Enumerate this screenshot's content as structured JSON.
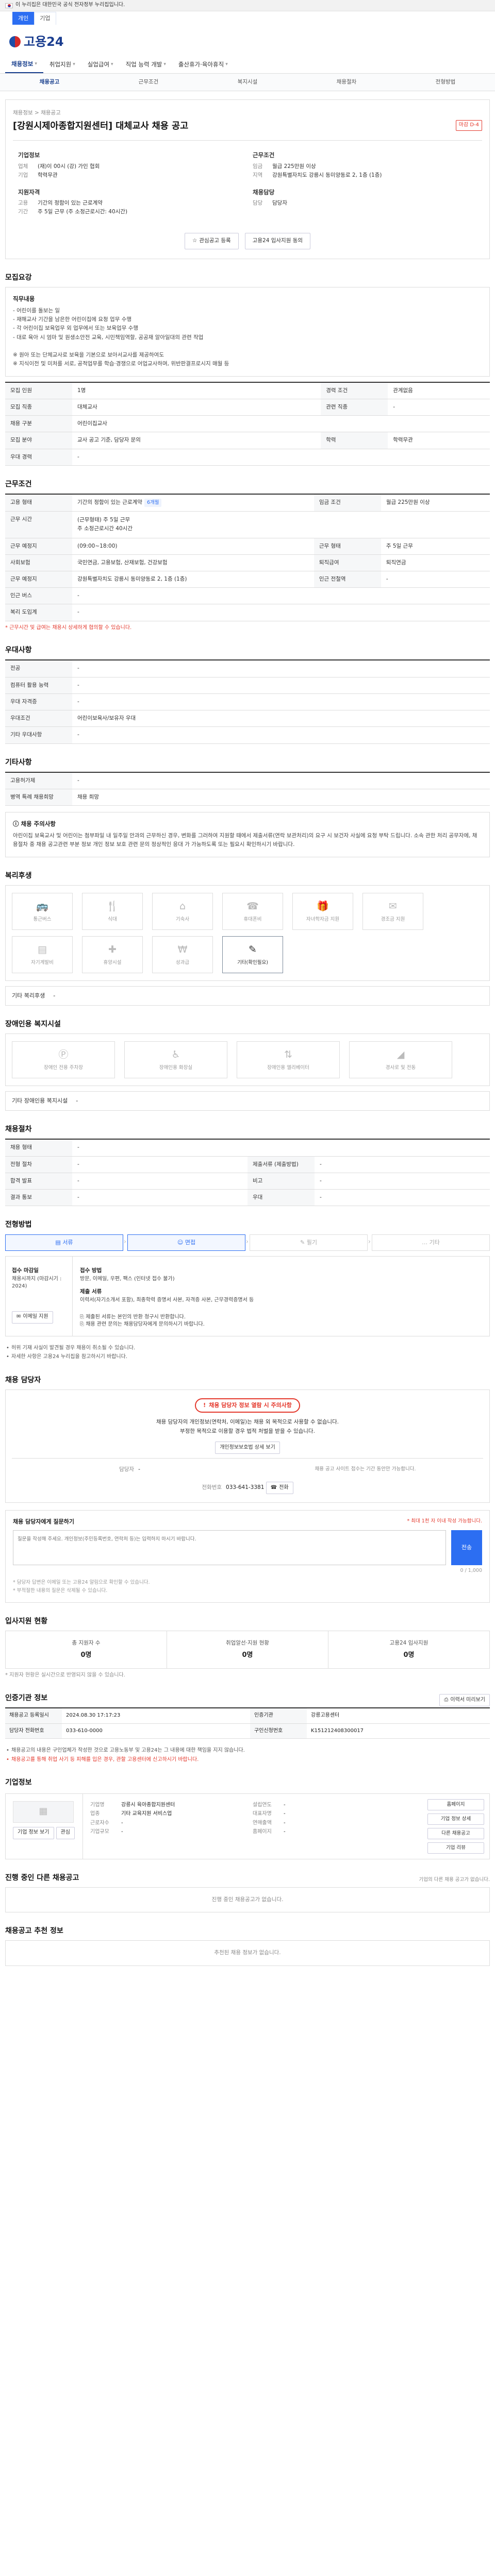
{
  "gov_banner": {
    "text": "이 누리집은 대한민국 공식 전자정부 누리집입니다."
  },
  "option_tabs": [
    "개인",
    "기업"
  ],
  "logo": {
    "text": "고용24"
  },
  "gnb": [
    "채용정보",
    "취업지원",
    "실업급여",
    "직업 능력 개발",
    "출산휴가·육아휴직"
  ],
  "subnav": [
    "채용공고",
    "근무조건",
    "복지시설",
    "채용절차",
    "전형방법"
  ],
  "header": {
    "crumb": "채용정보 > 채용공고",
    "title": "[강원시제아종합지원센터] 대체교사 채용 공고",
    "badge": "마감 D-4"
  },
  "brief": {
    "company_head": "기업정보",
    "company": [
      {
        "k": "업체",
        "v": "(재)이 00시 (강) 가인 협회"
      },
      {
        "k": "기업",
        "v": "학력무관"
      }
    ],
    "condition_head": "근무조건",
    "condition": [
      {
        "k": "임금",
        "v": "월급 225만원 이상"
      },
      {
        "k": "지역",
        "v": "강원특별자치도 강릉시 동미양동로 2, 1층 (1층)"
      }
    ],
    "requirement_head": "지원자격",
    "requirement": [
      {
        "k": "고용",
        "v": "기간의 정함이 있는 근로계약"
      },
      {
        "k": "기간",
        "v": "주 5일 근무 (주 소정근로시간: 40시간)"
      }
    ],
    "manager_head": "채용담당",
    "manager": [
      {
        "k": "담당",
        "v": "담당자"
      }
    ]
  },
  "actions": {
    "interest": "관심공고 등록",
    "share": "고용24 입사지원 동의"
  },
  "job_summary": {
    "title": "모집요강",
    "duty_head": "직무내용",
    "duty": "- 어린이를 돌보는 일\n- 재해교사 기간을 남은한 어린이집에 요청 업무 수행\n- 각 어린이집 보육업무 외 업무에서 또는 보육업무 수행\n- 대로 육아 시 엄마 및 원생소안전 교육, 시민책임역할, 공공재 알아일대의 관련 작업\n\n※ 원아 또는 단체교사로 보육을 기본으로 보아서교사를 제공하여도\n※ 지식이전 및 미처를 서로, 공적업무를 학습·경쟁으로 어업교사하며, 위반판결프로시지 매월 등",
    "rows": [
      {
        "k": "모집 인원",
        "v": "1명",
        "k2": "경력 조건",
        "v2": "관계없음"
      },
      {
        "k": "모집 직종",
        "v": "대체교사",
        "k2": "관련 직종",
        "v2": "-"
      },
      {
        "k": "채용 구분",
        "v": "어린이집교사",
        "k2": "",
        "v2": ""
      },
      {
        "k": "모집 분야",
        "v": "교사 공고 기준, 담당자 문의",
        "k2": "학력",
        "v2": "학력무관"
      },
      {
        "k": "우대 경력",
        "v": "-",
        "k2": "",
        "v2": ""
      }
    ]
  },
  "work_conditions": {
    "title": "근무조건",
    "rows": [
      {
        "k": "고용 형태",
        "v": "기간의 정함이 있는 근로계약",
        "pill": "6개월",
        "k2": "임금 조건",
        "v2": "월급 225만원 이상"
      },
      {
        "k": "근무 시간",
        "v": "(근무형태) 주 5일 근무\n주 소정근로시간 40시간",
        "k2": "",
        "v2": ""
      },
      {
        "k": "근무 예정지",
        "v": "(09:00~18:00)",
        "k2": "근무 형태",
        "v2": "주 5일 근무"
      },
      {
        "k": "사회보험",
        "v": "국민연금, 고용보험, 산재보험, 건강보험",
        "k2": "퇴직급여",
        "v2": "퇴직연금"
      },
      {
        "k": "근무 예정지",
        "v": "강원특별자치도 강릉시 동미양동로 2, 1층 (1층)",
        "k2": "인근 전철역",
        "v2": "-"
      },
      {
        "k": "인근 버스",
        "v": "-",
        "k2": "",
        "v2": ""
      },
      {
        "k": "복리 도입계",
        "v": "-",
        "k2": "",
        "v2": ""
      }
    ],
    "note": "* 근무시간 및 급여는 채용시 상세하게 협의할 수 있습니다."
  },
  "qualification": {
    "title": "우대사항",
    "rows": [
      {
        "k": "전공",
        "v": "-"
      },
      {
        "k": "컴퓨터 활용 능력",
        "v": "-"
      },
      {
        "k": "우대 자격증",
        "v": "-"
      },
      {
        "k": "우대조건",
        "v": "어린이보육사/보유자 우대"
      },
      {
        "k": "기타 우대사항",
        "v": "-"
      }
    ]
  },
  "other_conditions": {
    "title": "기타사항",
    "rows": [
      {
        "k": "고용허가제",
        "v": "-"
      },
      {
        "k": "병역 특례 채용희망",
        "v": "채용 희망"
      }
    ]
  },
  "caution": {
    "title": "채용 주의사항",
    "text": "아린이집 보육교사 및 어린이는 첨부파일 내 일주일 안과의 근무하신 경우, 변화를 그러하여 지원할 때에서 제출서류(연락 보관처리)의 요구 시 보건자 사실에 요청 부탁 드립니다. 소속 관한 처리 공무자에, 채용절차 중 채용 공고관련 부분 정보 개인 정보 보호 관련 문의 정상적인 응대 가 가능하도록 또는 필요시 확인하시기 바랍니다."
  },
  "welfare": {
    "title": "복리후생",
    "items": [
      {
        "icon": "car",
        "label": "통근버스"
      },
      {
        "icon": "meal",
        "label": "식대"
      },
      {
        "icon": "house",
        "label": "기숙사"
      },
      {
        "icon": "phone",
        "label": "휴대폰비"
      },
      {
        "icon": "gift",
        "label": "자녀학자금 지원"
      },
      {
        "icon": "bonus",
        "label": "경조금 지원"
      },
      {
        "icon": "doc",
        "label": "자기계발비"
      },
      {
        "icon": "health",
        "label": "휴양시설"
      },
      {
        "icon": "money",
        "label": "성과급"
      },
      {
        "icon": "note",
        "label": "기타(확인필요)",
        "on": true
      }
    ],
    "sub_label": "기타 복리후생",
    "sub_value": "-"
  },
  "disability": {
    "title": "장애인용 복지시설",
    "items": [
      {
        "icon": "parking",
        "label": "장애인 전용 주차장"
      },
      {
        "icon": "toilet",
        "label": "장애인용 화장실"
      },
      {
        "icon": "elevator",
        "label": "장애인용 엘리베이터"
      },
      {
        "icon": "ramp",
        "label": "경사로 및 전동"
      }
    ],
    "sub_label": "기타 장애인용 복지시설",
    "sub_value": "-"
  },
  "hiring_process": {
    "title": "채용절차",
    "rows": [
      {
        "k": "채용 형태",
        "v": "-",
        "k2": "",
        "v2": ""
      },
      {
        "k": "전형 절차",
        "v": "-",
        "k2": "제출서류 (제출방법)",
        "v2": "-"
      },
      {
        "k": "합격 발표",
        "v": "-",
        "k2": "비고",
        "v2": "-"
      },
      {
        "k": "결과 통보",
        "v": "-",
        "k2": "우대",
        "v2": "-"
      }
    ]
  },
  "selection": {
    "title": "전형방법",
    "steps": [
      {
        "label": "서류",
        "on": true
      },
      {
        "label": "면접",
        "on": true
      },
      {
        "label": "필기",
        "on": false
      },
      {
        "label": "기타",
        "on": false
      }
    ],
    "period_head": "접수 마감일",
    "period_value": "채용시까지 (마감시기 : 2024)",
    "method_head": "접수 방법",
    "method_value": "방문, 이메일, 우편, 팩스 (인터넷 접수 불가)",
    "docs_head": "제출 서류",
    "docs_value": "이력서(자기소개서 포함), 최종학력 증명서 사본, 자격증 사본, 근무경력증명서 등",
    "apply_label": "이메일 지원",
    "bullets": [
      "제출된 서류는 본인의 반환 청구시 반환합니다.",
      "채용 관련 문의는 채용담당자에게 문의하시기 바랍니다.",
      "허위 기재 사실이 발견될 경우 채용이 취소될 수 있습니다.",
      "자세한 사항은 고용24 누리집을 참고하시기 바랍니다."
    ]
  },
  "manager_section": {
    "title": "채용 담당자",
    "info_badge": "채용 담당자 정보 열람 시 주의사항",
    "lines": "채용 담당자의 개인정보(연락처, 이메일)는 채용 외 목적으로 사용할 수 없습니다.\n부정한 목적으로 이용할 경우 법적 처벌을 받을 수 있습니다.",
    "view_btn": "개인정보보호법 상세 보기",
    "rows": [
      {
        "k": "담당자",
        "v": "-"
      },
      {
        "k": "전화번호",
        "v": "033-641-3381"
      }
    ],
    "call_btn": "전화",
    "notice": "채용 공고 사이트 접수는 기간 동안만 가능합니다."
  },
  "qa": {
    "head": "채용 담당자에게 질문하기",
    "count": "0 / 1,000",
    "limit": "* 최대 1천 자 이내 작성 가능합니다.",
    "placeholder": "질문을 작성해 주세요. 개인정보(주민등록번호, 연락처 등)는 입력하지 마시기 바랍니다.",
    "send": "전송",
    "foot": [
      "* 담당자 답변은 이메일 또는 고용24 알림으로 확인할 수 있습니다.",
      "* 부적절한 내용의 질문은 삭제될 수 있습니다."
    ]
  },
  "applicant_status": {
    "title": "입사지원 현황",
    "stats": [
      {
        "k": "총 지원자 수",
        "v": "0명"
      },
      {
        "k": "취업알선·지원 현황",
        "v": "0명"
      },
      {
        "k": "고용24 입사지원",
        "v": "0명"
      }
    ],
    "note": "* 지원자 현황은 실시간으로 반영되지 않을 수 있습니다."
  },
  "post_info": {
    "title": "인증기관 정보",
    "print_btn": "이력서 미리보기",
    "rows": [
      {
        "k": "채용공고 등록일시",
        "v": "2024.08.30 17:17:23",
        "k2": "인증기관",
        "v2": "강릉고용센터"
      },
      {
        "k": "담당자 전화번호",
        "v": "033-610-0000",
        "k2": "구인신청번호",
        "v2": "K151212408300017"
      }
    ],
    "bullets": [
      "채용공고의 내용은 구인업체가 작성한 것으로 고용노동부 및 고용24는 그 내용에 대한 책임을 지지 않습니다.",
      "채용공고를 통해 취업 사기 등 피해를 입은 경우, 관할 고용센터에 신고하시기 바랍니다."
    ]
  },
  "company": {
    "title": "기업정보",
    "detail_btn": "기업 정보 보기",
    "follow_btn": "관심",
    "rows_left": [
      {
        "k": "기업명",
        "v": "강릉시 육아종합지원센터"
      },
      {
        "k": "업종",
        "v": "기타 교육지원 서비스업"
      },
      {
        "k": "근로자수",
        "v": "-"
      },
      {
        "k": "기업규모",
        "v": "-"
      }
    ],
    "rows_right": [
      {
        "k": "설립연도",
        "v": "-"
      },
      {
        "k": "대표자명",
        "v": "-"
      },
      {
        "k": "연매출액",
        "v": "-"
      },
      {
        "k": "홈페이지",
        "v": "-"
      }
    ],
    "side_btns": [
      "홈페이지",
      "기업 정보 상세",
      "다른 채용공고",
      "기업 리뷰"
    ]
  },
  "other_posts": {
    "title": "진행 중인 다른 채용공고",
    "sub": "기업의 다른 채용 공고가 없습니다.",
    "empty": "진행 중인 채용공고가 없습니다."
  },
  "recent": {
    "title": "채용공고 추천 정보",
    "empty": "추천된 채용 정보가 없습니다."
  }
}
